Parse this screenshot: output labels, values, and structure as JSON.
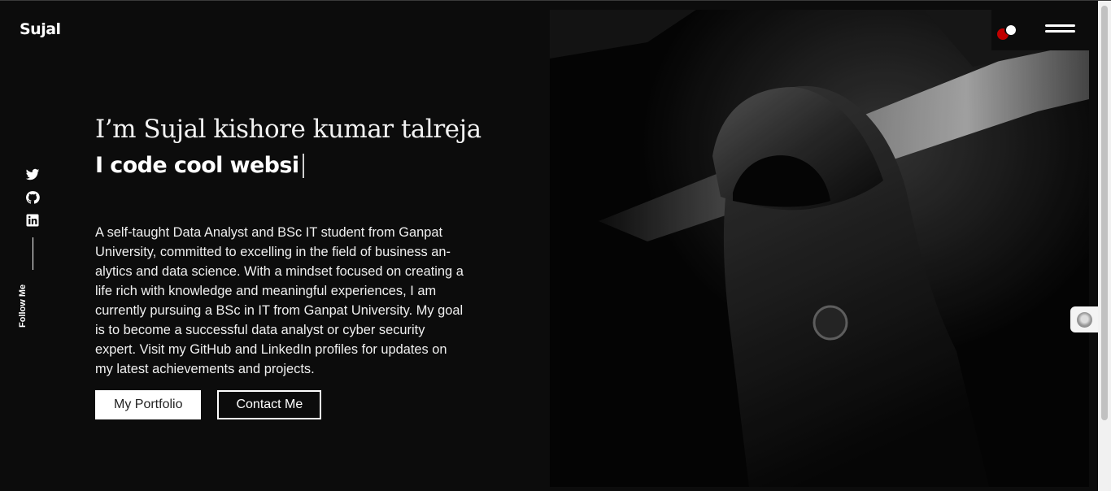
{
  "brand": {
    "logo_text": "Sujal"
  },
  "social": {
    "icons": [
      "twitter-icon",
      "github-icon",
      "linkedin-icon"
    ],
    "follow_label": "Follow Me"
  },
  "hero": {
    "greeting": "I’m Sujal kishore kumar talreja",
    "typing_text": "I code cool websi",
    "description": "A self-taught Data Analyst and BSc IT student from Ganpat University, committed to excelling in the field of business an-alytics and data science. With a mindset focused on creating a life rich with knowledge and meaningful experiences, I am currently pursuing a BSc in IT from Ganpat University. My goal is to become a successful data analyst or cyber security expert. Visit my GitHub and LinkedIn profiles for updates on my latest achievements and projects."
  },
  "buttons": {
    "portfolio_label": "My Portfolio",
    "contact_label": "Contact Me"
  },
  "header": {
    "theme_toggle_icon": "theme-toggle-icon",
    "menu_icon": "hamburger-menu-icon"
  },
  "colors": {
    "background": "#0c0c0c",
    "text": "#ffffff",
    "accent_red": "#c00000"
  }
}
